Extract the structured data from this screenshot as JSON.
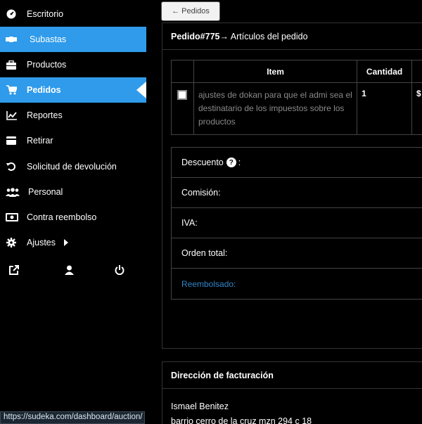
{
  "sidebar": {
    "items": [
      {
        "label": "Escritorio",
        "icon": "dashboard-icon"
      },
      {
        "label": "Subastas",
        "icon": "gavel-icon"
      },
      {
        "label": "Productos",
        "icon": "briefcase-icon"
      },
      {
        "label": "Pedidos",
        "icon": "cart-icon"
      },
      {
        "label": "Reportes",
        "icon": "chart-icon"
      },
      {
        "label": "Retirar",
        "icon": "wallet-icon"
      },
      {
        "label": "Solicitud de devolución",
        "icon": "undo-icon"
      },
      {
        "label": "Personal",
        "icon": "users-icon"
      },
      {
        "label": "Contra reembolso",
        "icon": "money-icon"
      },
      {
        "label": "Ajustes",
        "icon": "gear-icon"
      }
    ],
    "accent": "#2f9bea"
  },
  "status_url": "https://sudeka.com/dashboard/auction/",
  "main": {
    "back_label": "← Pedidos",
    "order_title_bold": "Pedido#775",
    "order_title_rest": " → Artículos del pedido",
    "table": {
      "headers": [
        "Item",
        "Cantidad"
      ],
      "rows": [
        {
          "item": "ajustes de dokan para que el admi sea el destinatario de los impuestos sobre los productos",
          "qty": "1",
          "price": "$"
        }
      ]
    },
    "totals": {
      "discount": "Descuento",
      "discount_suffix": ":",
      "commission": "Comisión:",
      "vat": "IVA:",
      "order_total": "Orden total:",
      "refunded": "Reembolsado:"
    },
    "billing": {
      "title": "Dirección de facturación",
      "name": "Ismael Benitez",
      "address": "barrio cerro de la cruz mzn 294 c 18"
    }
  }
}
